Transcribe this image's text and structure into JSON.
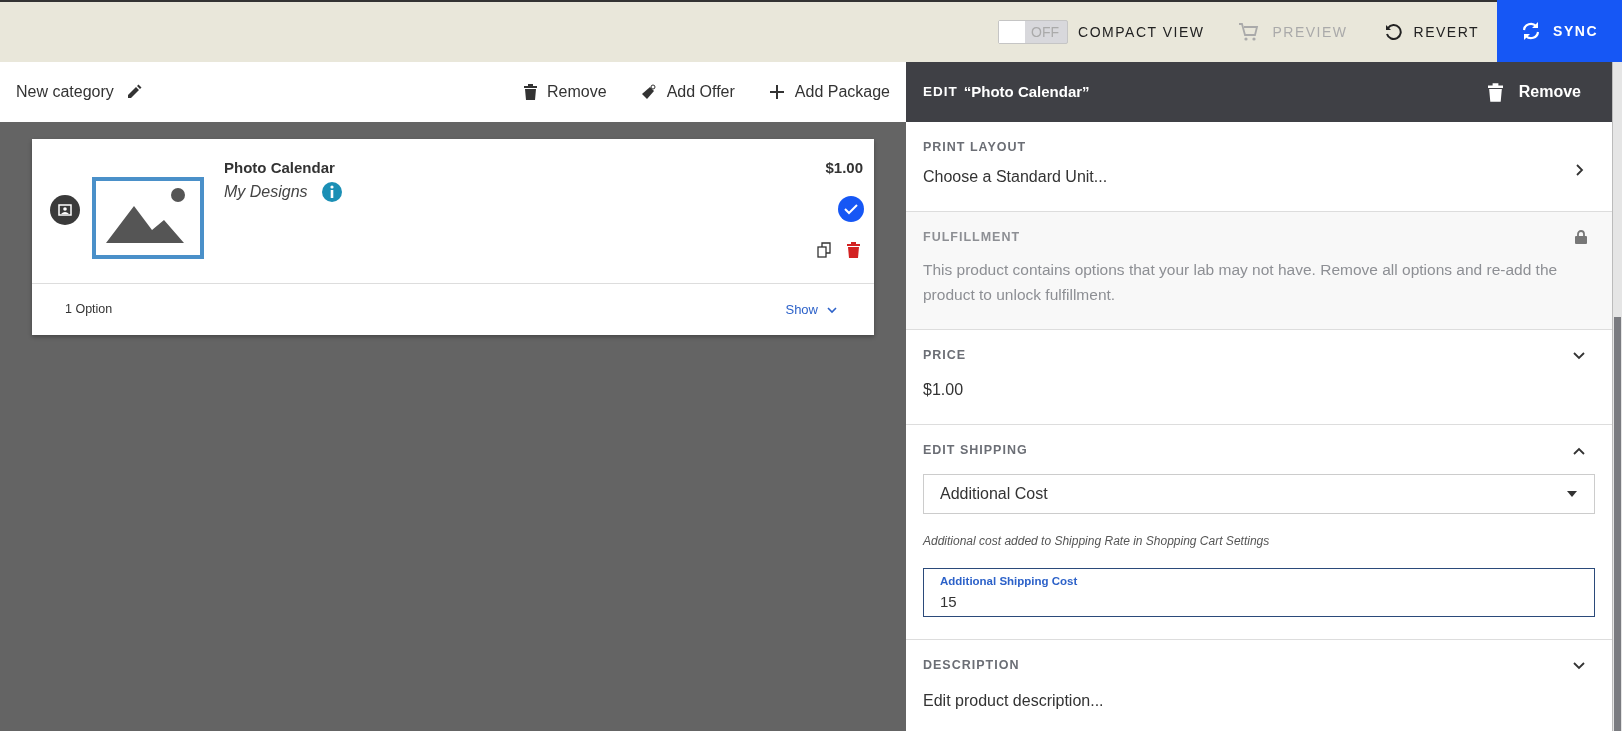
{
  "toolbar": {
    "compact_view": {
      "label": "COMPACT VIEW",
      "switch_text": "OFF",
      "on": false
    },
    "buttons": [
      {
        "label": "PREVIEW",
        "kind": "plain",
        "disabled": true
      },
      {
        "label": "REVERT",
        "kind": "plain",
        "disabled": false
      },
      {
        "label": "SYNC",
        "kind": "primary",
        "disabled": false
      }
    ]
  },
  "category_bar": {
    "name": "New category",
    "actions": [
      {
        "label": "Remove"
      },
      {
        "label": "Add Offer"
      },
      {
        "label": "Add Package"
      }
    ]
  },
  "product": {
    "title": "Photo Calendar",
    "subtitle": "My Designs",
    "price": "$1.00",
    "selected": true,
    "options": "1 Option",
    "toggle": "Show"
  },
  "editor": {
    "title_prefix": "EDIT",
    "title": "“Photo Calendar”",
    "remove": "Remove",
    "sections": [
      {
        "kind": "link",
        "heading": "PRINT LAYOUT",
        "value": "Choose a Standard Unit..."
      },
      {
        "kind": "locked",
        "heading": "FULFILLMENT",
        "text": "This product contains options that your lab may not have. Remove all options and re-add the product to unlock fulfillment."
      },
      {
        "kind": "collapsible",
        "heading": "PRICE",
        "expanded": false,
        "value": "$1.00"
      },
      {
        "kind": "shipping",
        "heading": "EDIT SHIPPING",
        "expanded": true,
        "select": "Additional Cost",
        "hint": "Additional cost added to Shipping Rate in Shopping Cart Settings",
        "field_label": "Additional Shipping Cost",
        "field_value": "15"
      },
      {
        "kind": "collapsible",
        "heading": "DESCRIPTION",
        "expanded": false,
        "value": "Edit product description..."
      }
    ]
  }
}
